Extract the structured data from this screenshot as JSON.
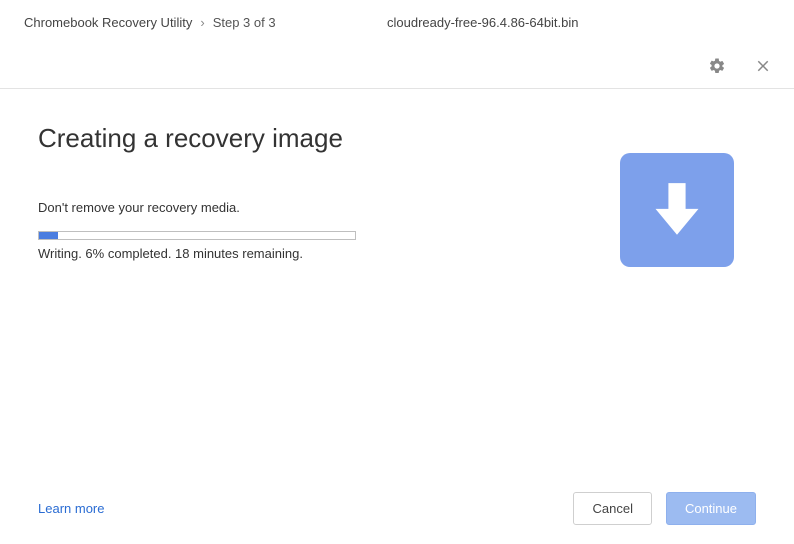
{
  "header": {
    "app_title": "Chromebook Recovery Utility",
    "chevron": "›",
    "step": "Step 3 of 3",
    "filename": "cloudready-free-96.4.86-64bit.bin"
  },
  "main": {
    "title": "Creating a recovery image",
    "instruction": "Don't remove your recovery media.",
    "progress_percent": 6,
    "progress_text": "Writing. 6% completed. 18 minutes remaining."
  },
  "footer": {
    "learn_more": "Learn more",
    "cancel": "Cancel",
    "continue": "Continue"
  },
  "colors": {
    "accent": "#7da0eb",
    "progress_fill": "#4a7de0",
    "link": "#2a6cd3"
  }
}
